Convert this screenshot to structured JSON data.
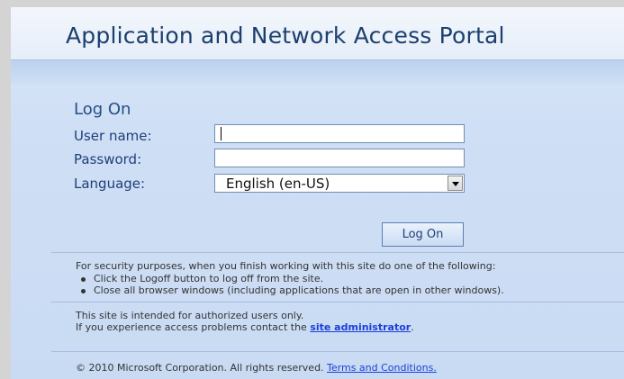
{
  "header": {
    "title": "Application and Network Access Portal"
  },
  "logon": {
    "title": "Log On",
    "username_label": "User name:",
    "username_value": "",
    "password_label": "Password:",
    "password_value": "",
    "language_label": "Language:",
    "language_value": "English (en-US)",
    "submit_label": "Log On"
  },
  "security": {
    "intro": "For security purposes, when you finish working with this site do one of the following:",
    "items": [
      "Click the Logoff button to log off from the site.",
      "Close all browser windows (including applications that are open in other windows)."
    ]
  },
  "authorization": {
    "line1": "This site is intended for authorized users only.",
    "line2_prefix": "If you experience access problems contact the ",
    "line2_link": "site administrator",
    "line2_suffix": "."
  },
  "footer": {
    "copyright": "© 2010 Microsoft Corporation. All rights reserved. ",
    "terms_link": "Terms and Conditions."
  },
  "colors": {
    "title": "#1b3f6e",
    "label": "#1f3f7a",
    "link": "#1a3fd8",
    "background": "#cfdff5"
  }
}
